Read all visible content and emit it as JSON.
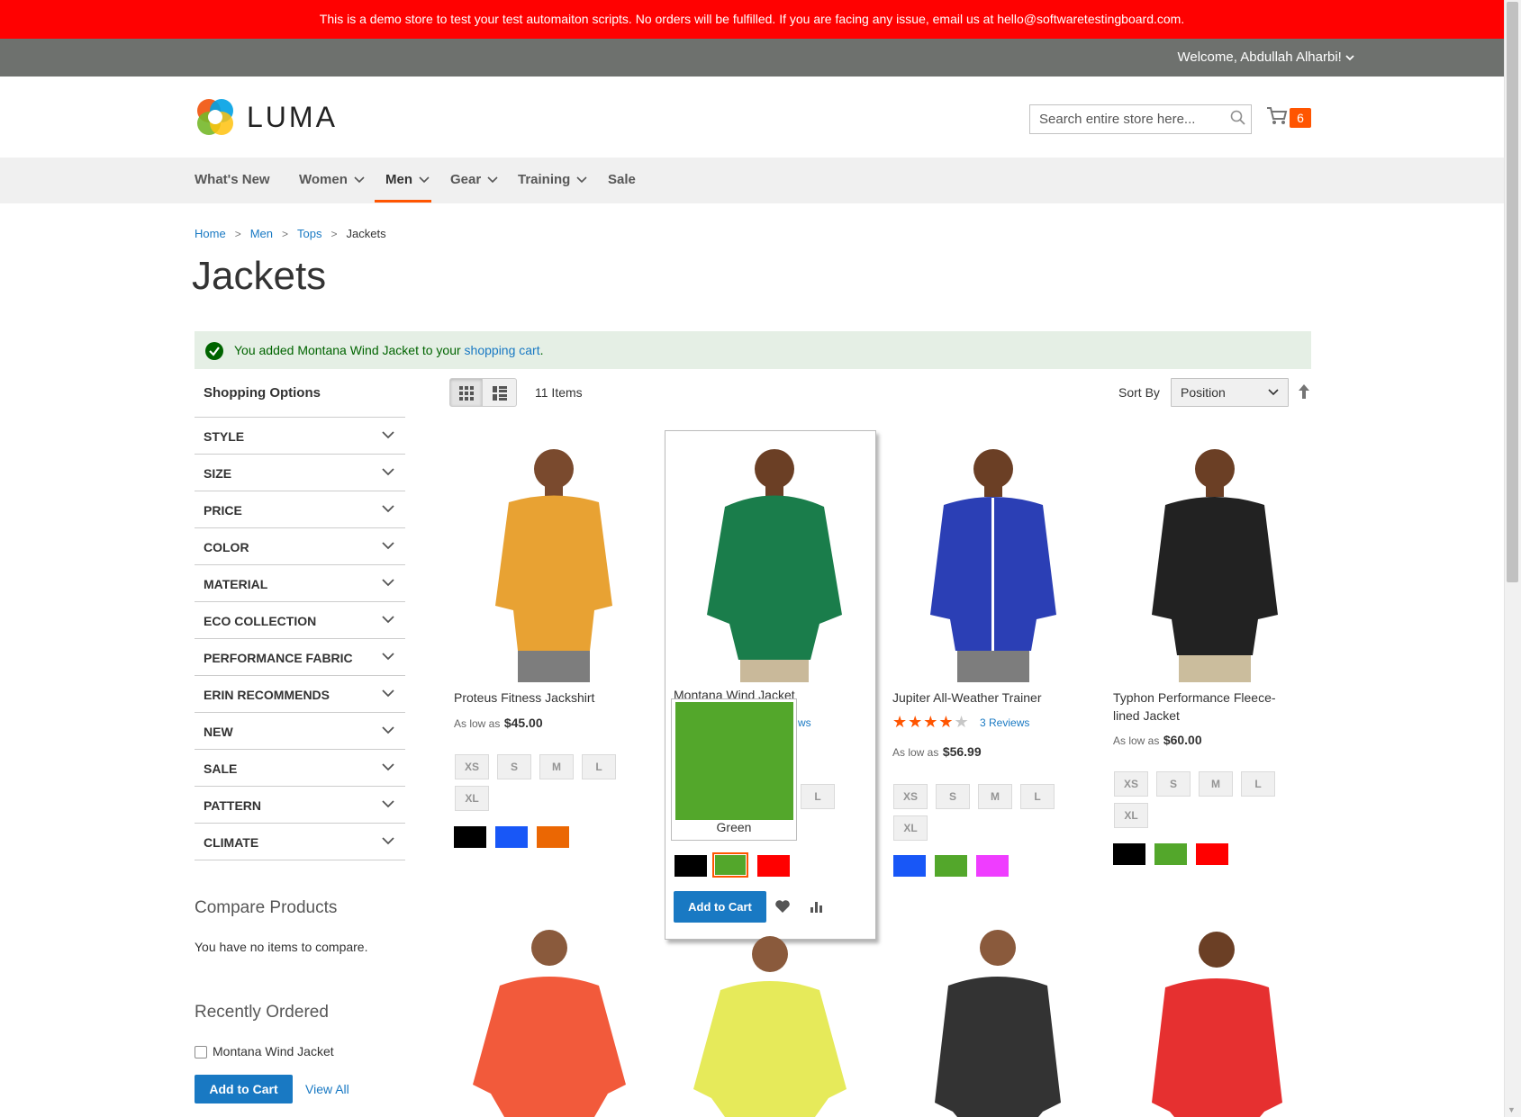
{
  "banner": {
    "text": "This is a demo store to test your test automaiton scripts. No orders will be fulfilled. If you are facing any issue, email us at hello@softwaretestingboard.com."
  },
  "topbar": {
    "welcome": "Welcome, Abdullah Alharbi!"
  },
  "header": {
    "logo_text": "LUMA",
    "search_placeholder": "Search entire store here...",
    "cart_count": "6"
  },
  "nav": {
    "items": [
      "What's New",
      "Women",
      "Men",
      "Gear",
      "Training",
      "Sale"
    ],
    "active": "Men"
  },
  "breadcrumb": [
    "Home",
    "Men",
    "Tops",
    "Jackets"
  ],
  "page_title": "Jackets",
  "message": {
    "prefix": "You added Montana Wind Jacket to your ",
    "link": "shopping cart",
    "suffix": "."
  },
  "sidebar": {
    "title": "Shopping Options",
    "filters": [
      "Style",
      "Size",
      "Price",
      "Color",
      "Material",
      "Eco Collection",
      "Performance Fabric",
      "Erin Recommends",
      "New",
      "Sale",
      "Pattern",
      "Climate"
    ]
  },
  "compare": {
    "title": "Compare Products",
    "empty": "You have no items to compare."
  },
  "recent": {
    "title": "Recently Ordered",
    "item": "Montana Wind Jacket",
    "add": "Add to Cart",
    "view_all": "View All"
  },
  "toolbar": {
    "amount": "11 Items",
    "sort_label": "Sort By",
    "sort_value": "Position"
  },
  "products": [
    {
      "name": "Proteus Fitness Jackshirt",
      "price_label": "As low as",
      "price": "$45.00",
      "sizes": [
        "XS",
        "S",
        "M",
        "L",
        "XL"
      ],
      "colors": [
        "#000000",
        "#1857f7",
        "#eb6703"
      ],
      "shirt": "#e8a233"
    },
    {
      "name": "Montana Wind Jacket",
      "reviews_partial": "ws",
      "sizes_partial": [
        "L"
      ],
      "colors": [
        "#000000",
        "#53a72b",
        "#ff0000"
      ],
      "shirt": "#1a7d4b"
    },
    {
      "name": "Jupiter All-Weather Trainer",
      "rating": 4,
      "reviews": "3 Reviews",
      "price_label": "As low as",
      "price": "$56.99",
      "sizes": [
        "XS",
        "S",
        "M",
        "L",
        "XL"
      ],
      "colors": [
        "#1857f7",
        "#53a72b",
        "#ef3dff"
      ],
      "shirt": "#2b3fb5"
    },
    {
      "name": "Typhon Performance Fleece-lined Jacket",
      "price_label": "As low as",
      "price": "$60.00",
      "sizes": [
        "XS",
        "S",
        "M",
        "L",
        "XL"
      ],
      "colors": [
        "#000000",
        "#53a72b",
        "#ff0000"
      ],
      "shirt": "#222222"
    }
  ],
  "row2_colors": [
    "#f25a3b",
    "#e6ea5a",
    "#333333",
    "#e63030"
  ],
  "hover": {
    "tooltip_label": "Green",
    "add_to_cart": "Add to Cart"
  }
}
